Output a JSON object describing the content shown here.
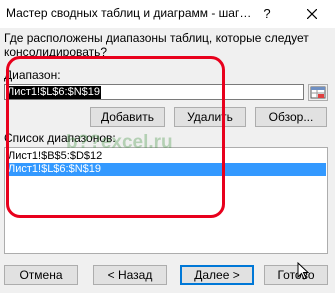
{
  "window": {
    "title": "Мастер сводных таблиц и диаграмм - шаг…",
    "help_label": "?"
  },
  "question": "Где расположены диапазоны таблиц, которые следует консолидировать?",
  "range": {
    "label_hotkey": "Д",
    "label_rest": "иапазон:",
    "value": "Лист1!$L$6:$N$19"
  },
  "buttons": {
    "add": "Добавить",
    "delete": "Удалить",
    "browse": "Обзор..."
  },
  "list": {
    "label": "Список диапазонов:",
    "items": [
      {
        "text": "Лист1!$B$5:$D$12",
        "selected": false
      },
      {
        "text": "Лист1!$L$6:$N$19",
        "selected": true
      }
    ]
  },
  "footer": {
    "cancel": "Отмена",
    "back": "< Назад",
    "next": "Далее >",
    "finish": "Готово"
  },
  "watermark": "b??excel.ru"
}
